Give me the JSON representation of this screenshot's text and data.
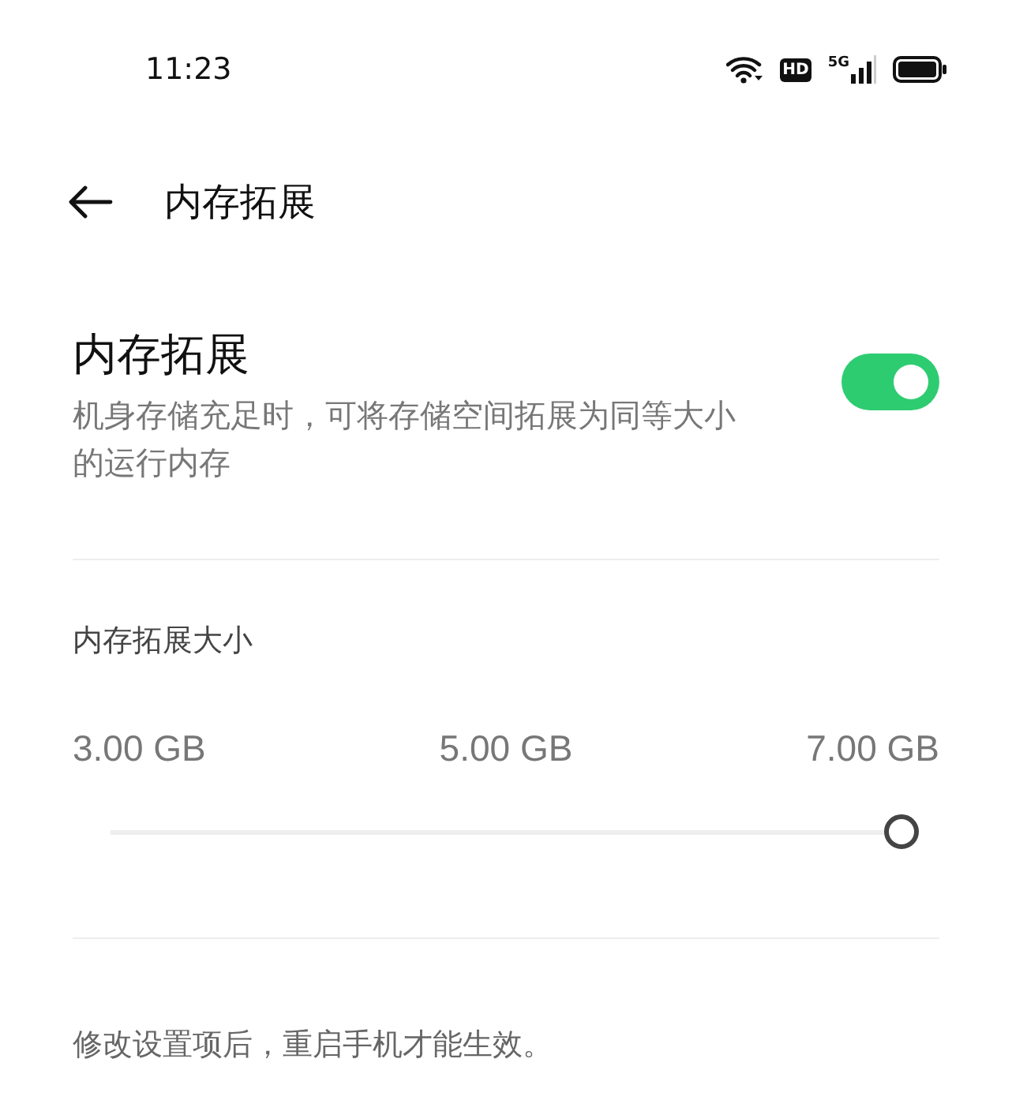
{
  "status_bar": {
    "time": "11:23",
    "hd": "HD",
    "network": "5G"
  },
  "header": {
    "title": "内存拓展"
  },
  "setting": {
    "title": "内存拓展",
    "description": "机身存储充足时，可将存储空间拓展为同等大小的运行内存",
    "on": true
  },
  "size": {
    "label": "内存拓展大小",
    "ticks": [
      "3.00 GB",
      "5.00 GB",
      "7.00 GB"
    ],
    "level": 1
  },
  "note": "修改设置项后，重启手机才能生效。"
}
